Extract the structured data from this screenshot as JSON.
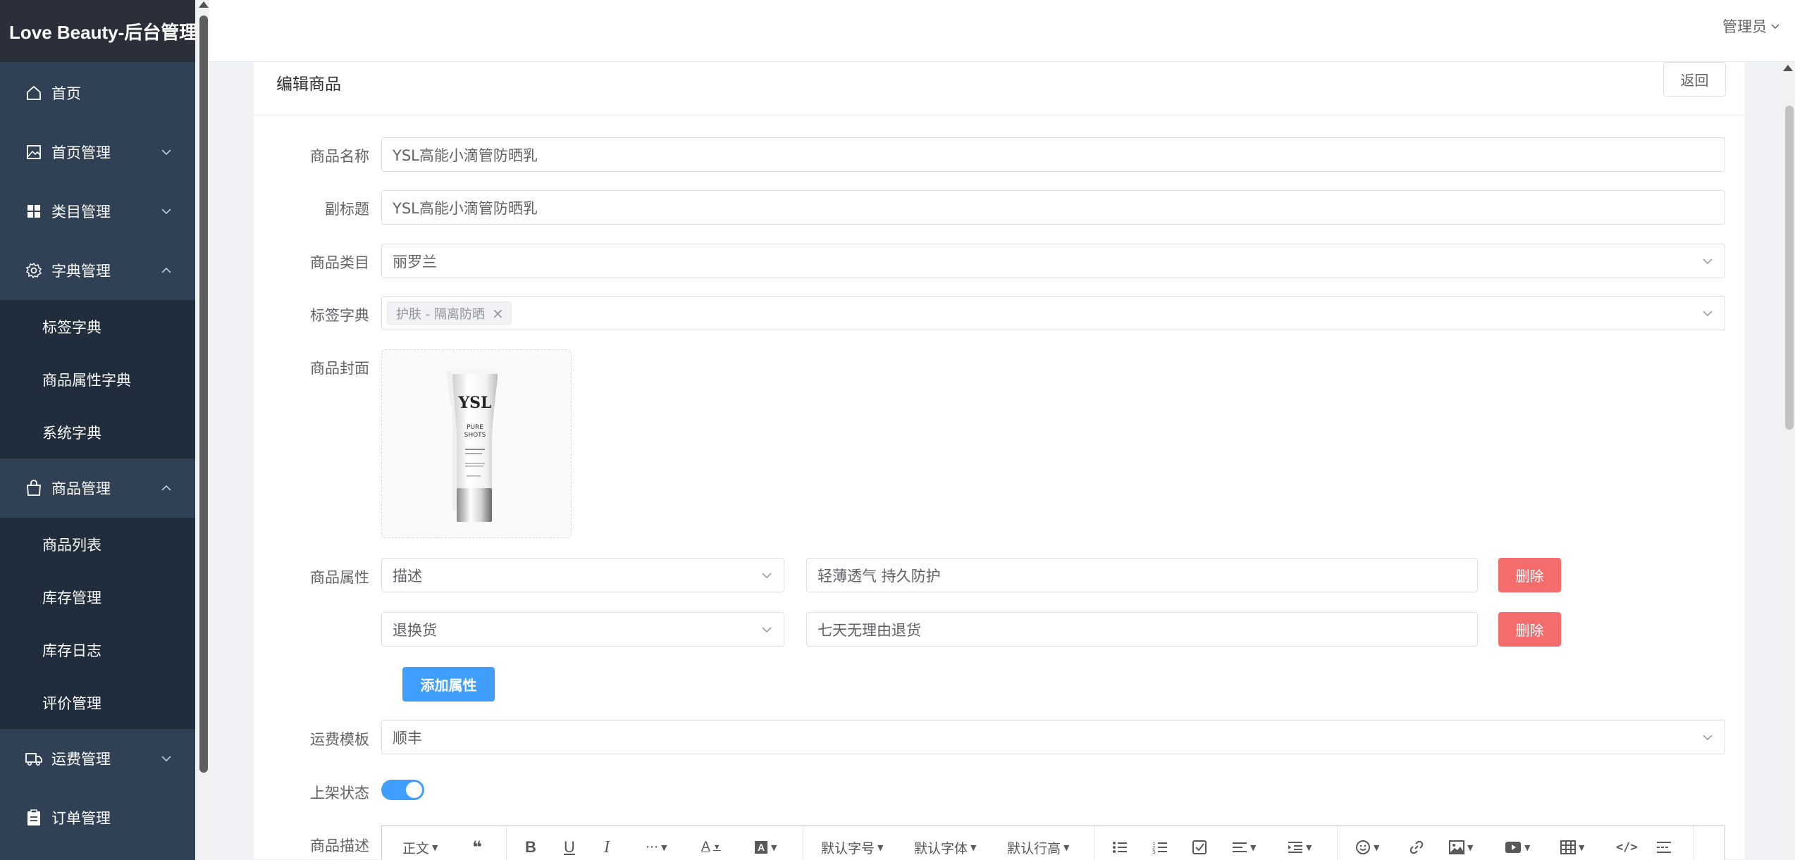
{
  "app": {
    "logo": "Love Beauty-后台管理"
  },
  "sidebar": {
    "items": [
      {
        "label": "首页",
        "icon": "home-icon"
      },
      {
        "label": "首页管理",
        "icon": "image-icon",
        "expanded": false
      },
      {
        "label": "类目管理",
        "icon": "grid-icon",
        "expanded": false
      },
      {
        "label": "字典管理",
        "icon": "gear-icon",
        "expanded": true,
        "children": [
          "标签字典",
          "商品属性字典",
          "系统字典"
        ]
      },
      {
        "label": "商品管理",
        "icon": "bag-icon",
        "expanded": true,
        "children": [
          "商品列表",
          "库存管理",
          "库存日志",
          "评价管理"
        ]
      },
      {
        "label": "运费管理",
        "icon": "truck-icon",
        "expanded": false
      },
      {
        "label": "订单管理",
        "icon": "clipboard-icon"
      }
    ]
  },
  "header": {
    "user": "管理员"
  },
  "card": {
    "title": "编辑商品",
    "back_label": "返回"
  },
  "form": {
    "name_label": "商品名称",
    "name_value": "YSL高能小滴管防晒乳",
    "subtitle_label": "副标题",
    "subtitle_value": "YSL高能小滴管防晒乳",
    "category_label": "商品类目",
    "category_value": "丽罗兰",
    "tags_label": "标签字典",
    "tags": [
      "护肤 - 隔离防晒"
    ],
    "cover_label": "商品封面",
    "cover_text": {
      "brand": "YSL",
      "line1": "PURE",
      "line2": "SHOTS"
    },
    "attr_label": "商品属性",
    "attributes": [
      {
        "key": "描述",
        "value": "轻薄透气 持久防护",
        "delete_label": "删除"
      },
      {
        "key": "退换货",
        "value": "七天无理由退货",
        "delete_label": "删除"
      }
    ],
    "add_attr_label": "添加属性",
    "shipping_label": "运费模板",
    "shipping_value": "顺丰",
    "status_label": "上架状态",
    "status_on": true,
    "desc_label": "商品描述"
  },
  "editor_toolbar": {
    "paragraph": "正文",
    "font_size": "默认字号",
    "font_family": "默认字体",
    "line_height": "默认行高"
  },
  "colors": {
    "sidebar": "#304156",
    "logo_bg": "#2b2f3a",
    "primary": "#409eff",
    "danger": "#f56c6c"
  }
}
